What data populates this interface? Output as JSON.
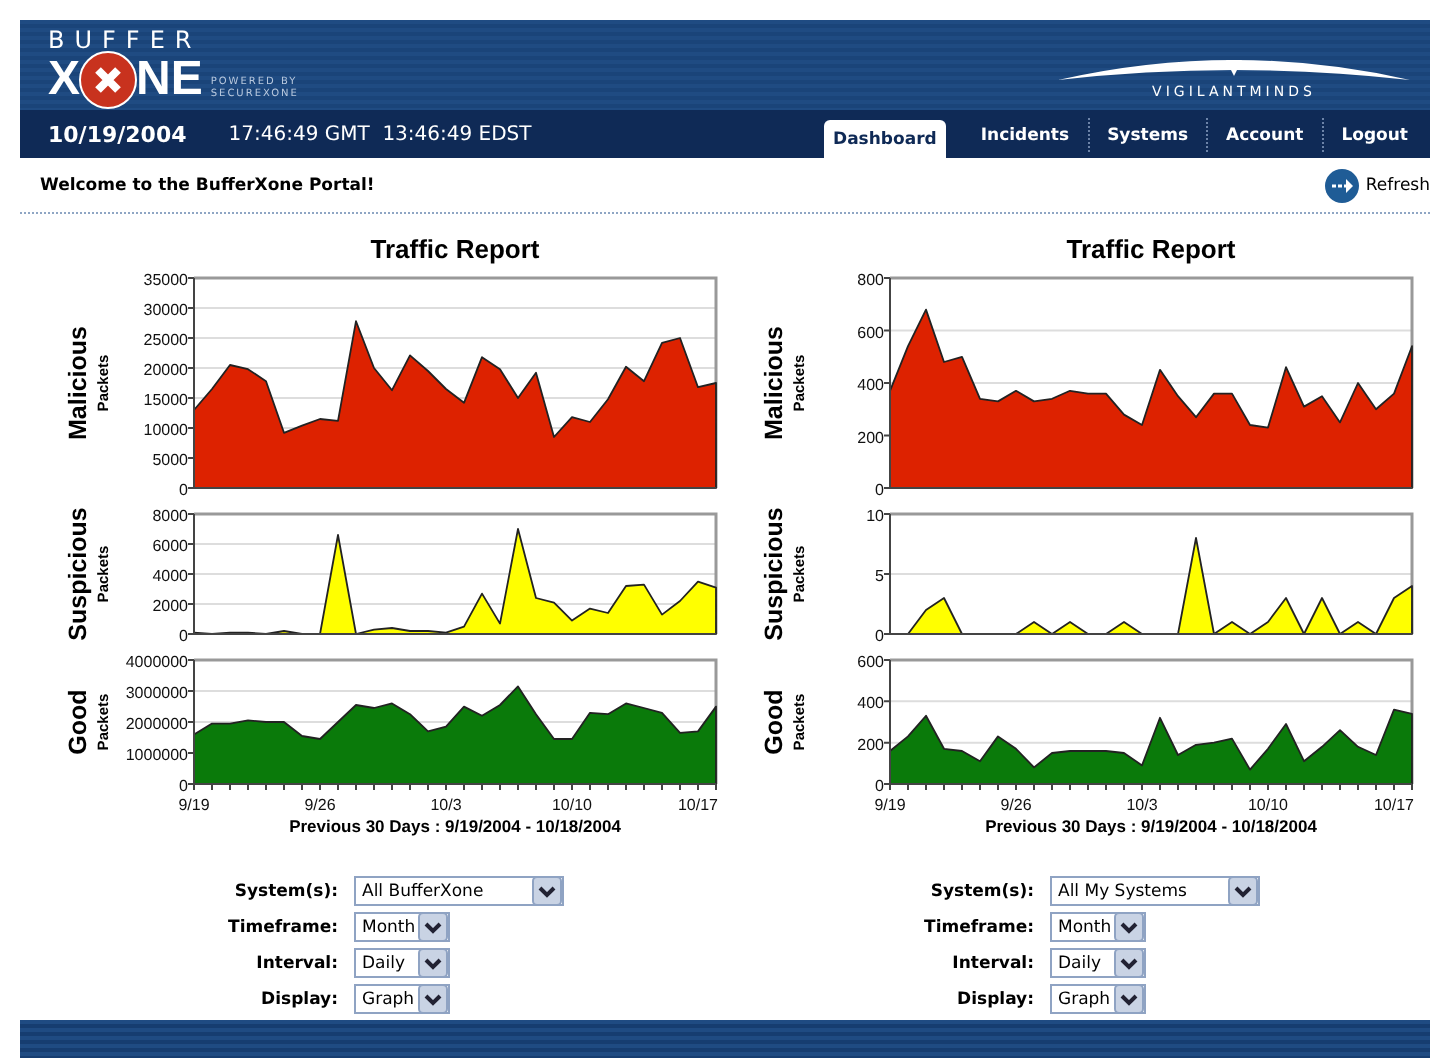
{
  "brand": {
    "top": "BUFFER",
    "left": "X",
    "right": "NE",
    "powered": "POWERED BY",
    "powered_by": "SECUREXONE",
    "partner": "VIGILANTMINDS"
  },
  "nav": {
    "date": "10/19/2004",
    "times": "17:46:49 GMT  13:46:49 EDST",
    "tabs": [
      {
        "label": "Dashboard",
        "selected": true
      },
      {
        "label": "Incidents",
        "selected": false
      },
      {
        "label": "Systems",
        "selected": false
      },
      {
        "label": "Account",
        "selected": false
      },
      {
        "label": "Logout",
        "selected": false
      }
    ]
  },
  "welcome": "Welcome to the BufferXone Portal!",
  "refresh": "Refresh",
  "reports": [
    {
      "title": "Traffic Report",
      "caption": "Previous 30 Days : 9/19/2004 - 10/18/2004",
      "panels": [
        {
          "unit": "Packets",
          "chart_data": {
            "type": "area",
            "ylabel": "Malicious",
            "grid": true,
            "ylim": [
              0,
              35000
            ],
            "yticks": [
              0,
              5000,
              10000,
              15000,
              20000,
              25000,
              30000,
              35000
            ],
            "series": [
              {
                "color": "#dd2200",
                "values": [
                  13000,
                  16500,
                  20500,
                  19800,
                  17800,
                  9200,
                  10400,
                  11500,
                  11200,
                  27800,
                  20000,
                  16300,
                  22100,
                  19500,
                  16500,
                  14200,
                  21800,
                  19800,
                  15000,
                  19200,
                  8500,
                  11800,
                  11000,
                  14800,
                  20200,
                  17800,
                  24200,
                  25000,
                  16800,
                  17500
                ]
              }
            ]
          }
        },
        {
          "unit": "Packets",
          "chart_data": {
            "type": "area",
            "ylabel": "Suspicious",
            "grid": true,
            "ylim": [
              0,
              8000
            ],
            "yticks": [
              0,
              2000,
              4000,
              6000,
              8000
            ],
            "series": [
              {
                "color": "#ffff00",
                "values": [
                  100,
                  0,
                  100,
                  100,
                  0,
                  200,
                  0,
                  0,
                  6600,
                  0,
                  300,
                  400,
                  200,
                  200,
                  100,
                  500,
                  2700,
                  700,
                  7000,
                  2400,
                  2100,
                  900,
                  1700,
                  1400,
                  3200,
                  3300,
                  1300,
                  2200,
                  3500,
                  3100
                ]
              }
            ]
          }
        },
        {
          "unit": "Packets",
          "chart_data": {
            "type": "area",
            "ylabel": "Good",
            "grid": true,
            "ylim": [
              0,
              4000000
            ],
            "yticks": [
              0,
              1000000,
              2000000,
              3000000,
              4000000
            ],
            "categories": [
              "9/19",
              null,
              null,
              null,
              null,
              null,
              null,
              "9/26",
              null,
              null,
              null,
              null,
              null,
              null,
              "10/3",
              null,
              null,
              null,
              null,
              null,
              null,
              "10/10",
              null,
              null,
              null,
              null,
              null,
              null,
              "10/17",
              null
            ],
            "series": [
              {
                "color": "#0a7a0a",
                "values": [
                  1600000,
                  1950000,
                  1950000,
                  2050000,
                  2000000,
                  2000000,
                  1550000,
                  1450000,
                  2000000,
                  2550000,
                  2450000,
                  2600000,
                  2250000,
                  1700000,
                  1850000,
                  2500000,
                  2200000,
                  2550000,
                  3150000,
                  2250000,
                  1450000,
                  1450000,
                  2300000,
                  2250000,
                  2600000,
                  2450000,
                  2300000,
                  1650000,
                  1700000,
                  2500000
                ]
              }
            ]
          }
        }
      ],
      "filters": [
        {
          "label": "System(s):",
          "value": "All BufferXone",
          "kind": "wide"
        },
        {
          "label": "Timeframe:",
          "value": "Month",
          "kind": "narrow"
        },
        {
          "label": "Interval:",
          "value": "Daily",
          "kind": "narrow"
        },
        {
          "label": "Display:",
          "value": "Graph",
          "kind": "narrow"
        }
      ]
    },
    {
      "title": "Traffic Report",
      "caption": "Previous 30 Days : 9/19/2004 - 10/18/2004",
      "panels": [
        {
          "unit": "Packets",
          "chart_data": {
            "type": "area",
            "ylabel": "Malicious",
            "grid": true,
            "ylim": [
              0,
              800
            ],
            "yticks": [
              0,
              200,
              400,
              600,
              800
            ],
            "series": [
              {
                "color": "#dd2200",
                "values": [
                  370,
                  540,
                  680,
                  480,
                  500,
                  340,
                  330,
                  370,
                  330,
                  340,
                  370,
                  360,
                  360,
                  280,
                  240,
                  450,
                  350,
                  270,
                  360,
                  360,
                  240,
                  230,
                  460,
                  310,
                  350,
                  250,
                  400,
                  300,
                  360,
                  540
                ]
              }
            ]
          }
        },
        {
          "unit": "Packets",
          "chart_data": {
            "type": "area",
            "ylabel": "Suspicious",
            "grid": true,
            "ylim": [
              0,
              10
            ],
            "yticks": [
              0,
              5,
              10
            ],
            "series": [
              {
                "color": "#ffff00",
                "values": [
                  0,
                  0,
                  2,
                  3,
                  0,
                  0,
                  0,
                  0,
                  1,
                  0,
                  1,
                  0,
                  0,
                  1,
                  0,
                  0,
                  0,
                  8,
                  0,
                  1,
                  0,
                  1,
                  3,
                  0,
                  3,
                  0,
                  1,
                  0,
                  3,
                  4
                ]
              }
            ]
          }
        },
        {
          "unit": "Packets",
          "chart_data": {
            "type": "area",
            "ylabel": "Good",
            "grid": true,
            "ylim": [
              0,
              600
            ],
            "yticks": [
              0,
              200,
              400,
              600
            ],
            "categories": [
              "9/19",
              null,
              null,
              null,
              null,
              null,
              null,
              "9/26",
              null,
              null,
              null,
              null,
              null,
              null,
              "10/3",
              null,
              null,
              null,
              null,
              null,
              null,
              "10/10",
              null,
              null,
              null,
              null,
              null,
              null,
              "10/17",
              null
            ],
            "series": [
              {
                "color": "#0a7a0a",
                "values": [
                  160,
                  230,
                  330,
                  170,
                  160,
                  110,
                  230,
                  170,
                  80,
                  150,
                  160,
                  160,
                  160,
                  150,
                  90,
                  320,
                  140,
                  190,
                  200,
                  220,
                  70,
                  170,
                  290,
                  110,
                  180,
                  260,
                  180,
                  140,
                  360,
                  340
                ]
              }
            ]
          }
        }
      ],
      "filters": [
        {
          "label": "System(s):",
          "value": "All My Systems",
          "kind": "wide"
        },
        {
          "label": "Timeframe:",
          "value": "Month",
          "kind": "narrow"
        },
        {
          "label": "Interval:",
          "value": "Daily",
          "kind": "narrow"
        },
        {
          "label": "Display:",
          "value": "Graph",
          "kind": "narrow"
        }
      ]
    }
  ]
}
